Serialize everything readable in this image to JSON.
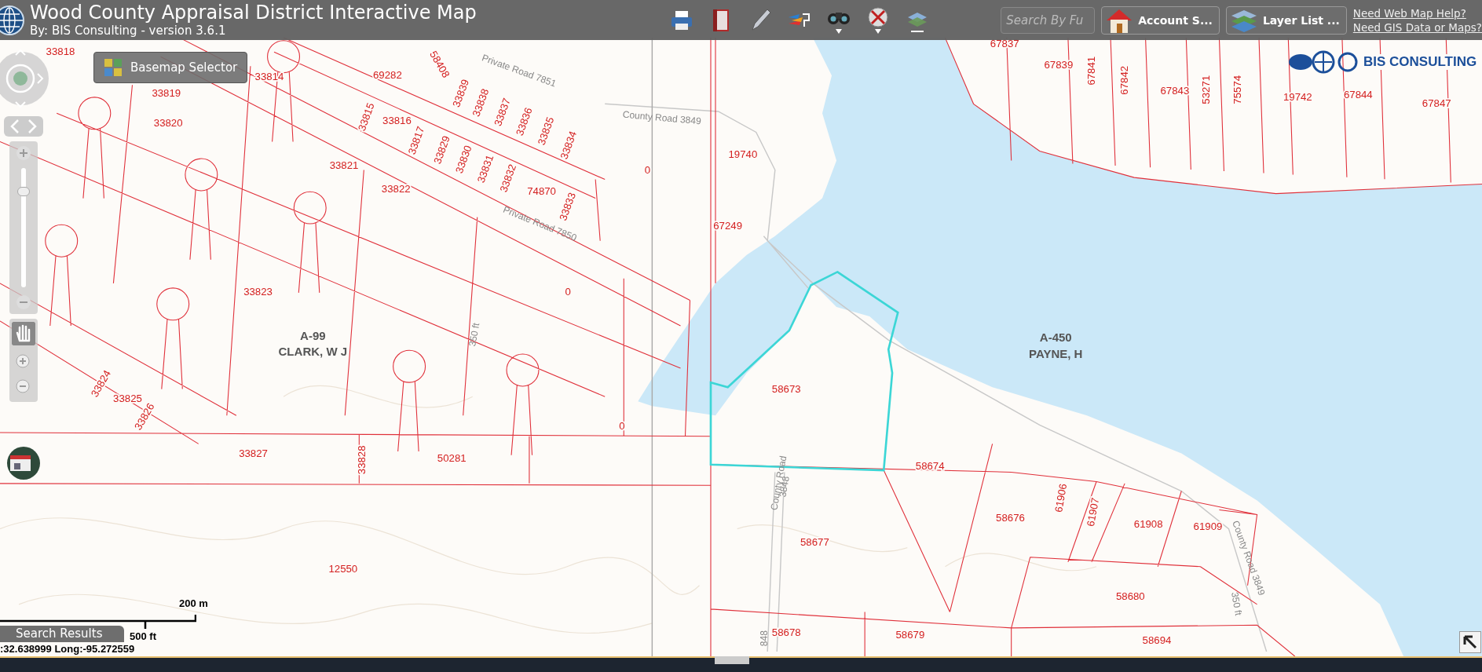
{
  "header": {
    "title": "Wood County Appraisal District Interactive Map",
    "subtitle": "By: BIS Consulting - version 3.6.1"
  },
  "search": {
    "placeholder": "Search By Fu"
  },
  "account_button": "Account S...",
  "layer_list_button": "Layer List ...",
  "help_links": [
    "Need Web Map Help?",
    "Need GIS Data or Maps?"
  ],
  "logo": "BIS CONSULTING",
  "basemap_button": "Basemap Selector",
  "zoom_slider": {
    "level": 0.8
  },
  "map": {
    "parcels": [
      "33818",
      "33814",
      "69282",
      "58408",
      "33819",
      "33820",
      "33815",
      "33816",
      "33839",
      "33838",
      "33837",
      "33836",
      "33835",
      "33834",
      "33817",
      "33829",
      "33830",
      "33831",
      "33832",
      "74870",
      "33833",
      "33821",
      "33822",
      "0",
      "19740",
      "67249",
      "33823",
      "0",
      "33824",
      "33825",
      "33826",
      "0",
      "58673",
      "33827",
      "33828",
      "50281",
      "58674",
      "58676",
      "61906",
      "61907",
      "61908",
      "61909",
      "58677",
      "12550",
      "58680",
      "58678",
      "58679",
      "58694",
      "67837",
      "67839",
      "67841",
      "67842",
      "67843",
      "53271",
      "75574",
      "19742",
      "67844",
      "67847"
    ],
    "owners": [
      {
        "abstract": "A-99",
        "name": "CLARK, W J"
      },
      {
        "abstract": "A-450",
        "name": "PAYNE, H"
      }
    ],
    "roads": [
      "Private Road 7851",
      "County Road 3849",
      "Private Road 7850",
      "350 ft",
      "County Road",
      "3848",
      "County Road 3849",
      "350 ft",
      "848"
    ]
  },
  "scale_bar": {
    "metric": "200 m",
    "imperial": "500 ft"
  },
  "search_results_tab": "Search Results",
  "coordinates": ":32.638999 Long:-95.272559"
}
